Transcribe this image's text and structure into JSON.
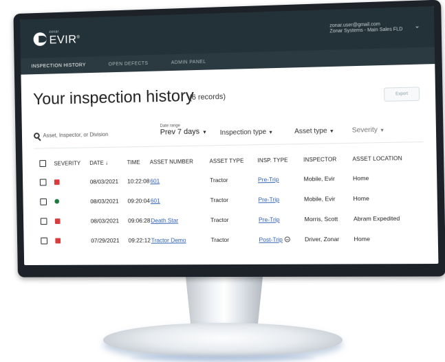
{
  "header": {
    "brand_small": "zonar",
    "app_name": "EVIR",
    "registered_mark": "®",
    "account_email": "zonar.user@gmail.com",
    "account_org": "Zonar Systems - Main Sales FLD",
    "chevron_icon": "chevron-down-icon"
  },
  "nav": {
    "tabs": [
      {
        "label": "INSPECTION HISTORY",
        "active": true
      },
      {
        "label": "OPEN DEFECTS",
        "active": false
      },
      {
        "label": "ADMIN PANEL",
        "active": false
      }
    ]
  },
  "page": {
    "title": "Your inspection history",
    "record_count": "(6 records)",
    "export_label": "Export"
  },
  "filters": {
    "search_placeholder": "Asset, Inspector, or Division",
    "date_range_label": "Date range",
    "date_range_value": "Prev 7 days",
    "inspection_type": "Inspection type",
    "asset_type": "Asset type",
    "severity": "Severity"
  },
  "table": {
    "columns": [
      "SEVERITY",
      "DATE",
      "TIME",
      "ASSET NUMBER",
      "ASSET TYPE",
      "INSP. TYPE",
      "INSPECTOR",
      "ASSET LOCATION"
    ],
    "sort_indicator": "↓",
    "rows": [
      {
        "severity": "red",
        "date": "08/03/2021",
        "time": "10:22:08",
        "asset": "601",
        "asset_type": "Tractor",
        "insp_type": "Pre-Trip",
        "inspector": "Mobile, Evir",
        "location": "Home",
        "has_info": false
      },
      {
        "severity": "green",
        "date": "08/03/2021",
        "time": "09:20:04",
        "asset": "601",
        "asset_type": "Tractor",
        "insp_type": "Pre-Trip",
        "inspector": "Mobile, Evir",
        "location": "Home",
        "has_info": false
      },
      {
        "severity": "red",
        "date": "08/03/2021",
        "time": "09:06:28",
        "asset": "Death Star",
        "asset_type": "Tractor",
        "insp_type": "Pre-Trip",
        "inspector": "Morris, Scott",
        "location": "Abram Expedited",
        "has_info": false
      },
      {
        "severity": "red",
        "date": "07/29/2021",
        "time": "09:22:12",
        "asset": "Tractor Demo",
        "asset_type": "Tractor",
        "insp_type": "Post-Trip",
        "inspector": "Driver, Zonar",
        "location": "Home",
        "has_info": true
      }
    ]
  },
  "colors": {
    "header_bg": "#233238",
    "nav_bg": "#2b3a40",
    "severity_red": "#d83c3c",
    "severity_green": "#1e7a3c",
    "link": "#2d5fb4"
  }
}
